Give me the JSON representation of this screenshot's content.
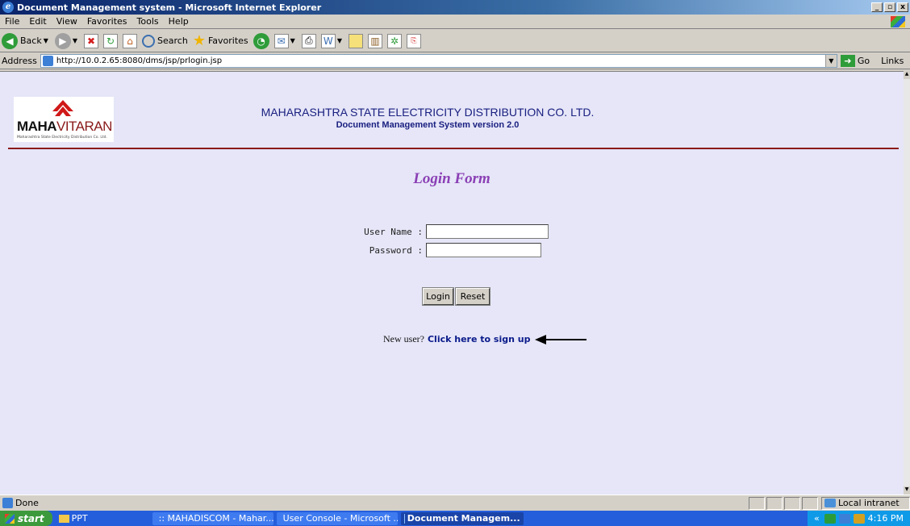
{
  "window": {
    "title": "Document Management system - Microsoft Internet Explorer",
    "buttons": [
      "_",
      " ",
      "x"
    ]
  },
  "menu": {
    "items": [
      "File",
      "Edit",
      "View",
      "Favorites",
      "Tools",
      "Help"
    ]
  },
  "toolbar": {
    "back_label": "Back",
    "search_label": "Search",
    "favorites_label": "Favorites"
  },
  "address": {
    "label": "Address",
    "url": "http://10.0.2.65:8080/dms/jsp/prlogin.jsp",
    "go_label": "Go",
    "links_label": "Links"
  },
  "page": {
    "logo": {
      "brand_bold": "MAHA",
      "brand_regular": "VITARAN",
      "tagline": "Maharashtra State Electricity Distribution Co. Ltd."
    },
    "org_title": "MAHARASHTRA STATE ELECTRICITY DISTRIBUTION CO. LTD.",
    "org_subtitle": "Document Management System version 2.0",
    "form_heading": "Login Form",
    "username_label": "User Name :",
    "username_value": "",
    "password_label": "Password :",
    "password_value": "",
    "login_button": "Login",
    "reset_button": "Reset",
    "signup_prefix": "New user?",
    "signup_link": "Click here to sign up"
  },
  "statusbar": {
    "status": "Done",
    "zone": "Local intranet"
  },
  "taskbar": {
    "start": "start",
    "quick_folder": "PPT",
    "tasks": [
      ":: MAHADISCOM - Mahar...",
      "User Console - Microsoft ...",
      "Document Managem..."
    ],
    "tray_arrows": "«",
    "clock": "4:16 PM"
  },
  "colors": {
    "content_bg": "#e6e6f8",
    "heading": "#8b3fb5",
    "rule": "#8b1a1a",
    "org_text": "#1a2080"
  }
}
